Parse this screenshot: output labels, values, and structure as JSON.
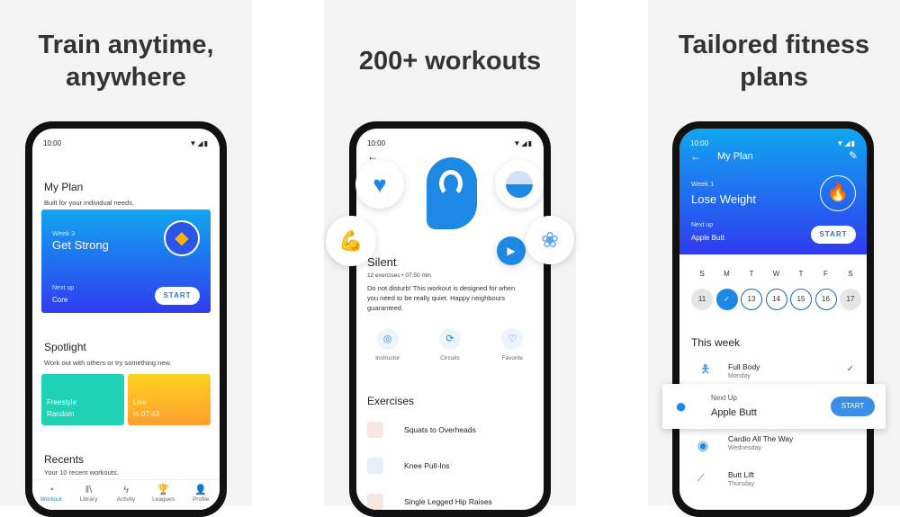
{
  "panels": [
    {
      "headline_1": "Train anytime,",
      "headline_2": "anywhere"
    },
    {
      "headline_1": "200+ workouts"
    },
    {
      "headline_1": "Tailored fitness",
      "headline_2": "plans"
    }
  ],
  "status": {
    "time": "10:00",
    "icons": "▼◢▮"
  },
  "screen1": {
    "title": "My Plan",
    "subtitle": "Built for your individual needs.",
    "plan": {
      "week": "Week 3",
      "name": "Get Strong",
      "next_label": "Next up",
      "next": "Core",
      "start": "START",
      "icon": "diamond-icon"
    },
    "spotlight_title": "Spotlight",
    "spotlight_sub": "Work out with others or try something new.",
    "cards": [
      {
        "title": "Freestyle",
        "sub": "Random",
        "color": "#1fd1b5"
      },
      {
        "title": "Live",
        "sub": "In 07:43",
        "color": "#ffb21f"
      }
    ],
    "recents_title": "Recents",
    "recents_sub": "Your 10 recent workouts.",
    "nav": [
      {
        "label": "Workout",
        "icon": "◔"
      },
      {
        "label": "Library",
        "icon": "ǁ\\"
      },
      {
        "label": "Activity",
        "icon": "ϟ"
      },
      {
        "label": "Leagues",
        "icon": "🏆"
      },
      {
        "label": "Profile",
        "icon": "👤"
      }
    ]
  },
  "screen2": {
    "back": "←",
    "title": "Silent",
    "meta": "12 exercises • 07:50 min",
    "desc": "Do not disturb! This workout is designed for when you need to be really quiet. Happy neighbours guaranteed.",
    "actions": [
      {
        "label": "Instructor",
        "icon": "◎"
      },
      {
        "label": "Circuits",
        "icon": "⟳"
      },
      {
        "label": "Favorite",
        "icon": "♡"
      }
    ],
    "exercises_title": "Exercises",
    "exercises": [
      "Squats to Overheads",
      "Knee Pull-Ins",
      "Single Legged Hip Raises"
    ]
  },
  "screen3": {
    "back": "←",
    "title": "My Plan",
    "edit": "✎",
    "week": "Week 1",
    "plan": "Lose Weight",
    "next_label": "Next up",
    "next": "Apple Butt",
    "start": "START",
    "days": [
      {
        "l": "S",
        "n": "11",
        "state": "past"
      },
      {
        "l": "M",
        "n": "✓",
        "state": "done"
      },
      {
        "l": "T",
        "n": "13",
        "state": "upcoming"
      },
      {
        "l": "W",
        "n": "14",
        "state": "upcoming"
      },
      {
        "l": "T",
        "n": "15",
        "state": "upcoming"
      },
      {
        "l": "F",
        "n": "16",
        "state": "upcoming"
      },
      {
        "l": "S",
        "n": "17",
        "state": "past"
      }
    ],
    "this_week": "This week",
    "items": [
      {
        "name": "Full Body",
        "day": "Monday",
        "done": "✓"
      },
      {
        "name": "Cardio All The Way",
        "day": "Wednesday"
      },
      {
        "name": "Butt Lift",
        "day": "Thursday"
      }
    ],
    "next_card": {
      "label": "Next Up",
      "name": "Apple Butt",
      "start": "START"
    }
  },
  "colors": {
    "accent": "#1e88e5",
    "gradient_top": "#11a6f0",
    "gradient_bottom": "#2f3bf0"
  }
}
